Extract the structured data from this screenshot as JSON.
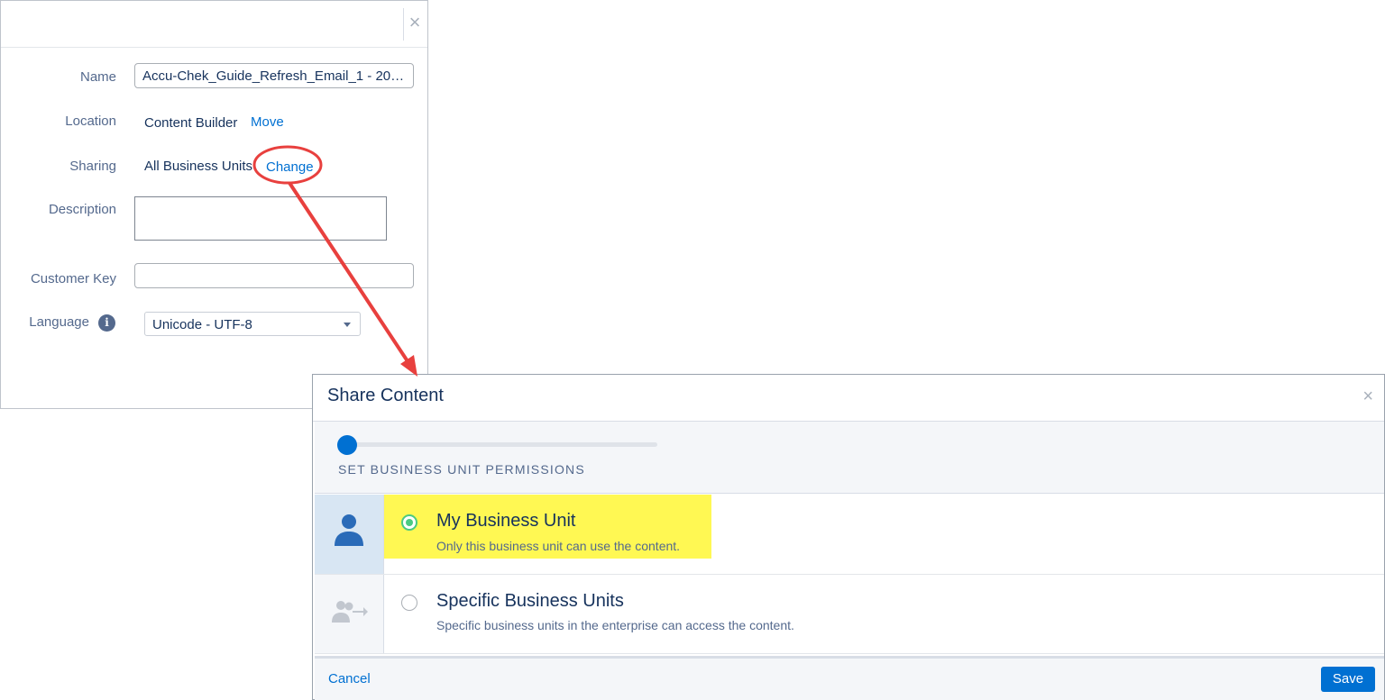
{
  "properties": {
    "name_label": "Name",
    "name_value": "Accu-Chek_Guide_Refresh_Email_1 - 2020...",
    "location_label": "Location",
    "location_value": "Content Builder",
    "location_move_link": "Move",
    "sharing_label": "Sharing",
    "sharing_value": "All Business Units",
    "sharing_change_link": "Change",
    "description_label": "Description",
    "description_value": "",
    "customer_key_label": "Customer Key",
    "customer_key_value": "",
    "language_label": "Language",
    "language_info_icon": "i",
    "language_value": "Unicode - UTF-8",
    "close_icon": "×"
  },
  "share_dialog": {
    "title": "Share Content",
    "close_icon": "×",
    "step_label": "SET BUSINESS UNIT PERMISSIONS",
    "options": [
      {
        "title": "My Business Unit",
        "description": "Only this business unit can use the content.",
        "icon": "user-icon",
        "selected": true
      },
      {
        "title": "Specific Business Units",
        "description": "Specific business units in the enterprise can access the content.",
        "icon": "users-share-icon",
        "selected": false
      }
    ],
    "cancel_label": "Cancel",
    "save_label": "Save"
  },
  "colors": {
    "link": "#0070d2",
    "annotation": "#e8403e",
    "highlight": "#fff853",
    "selected_radio": "#4bca81",
    "primary_button": "#0070d2"
  }
}
